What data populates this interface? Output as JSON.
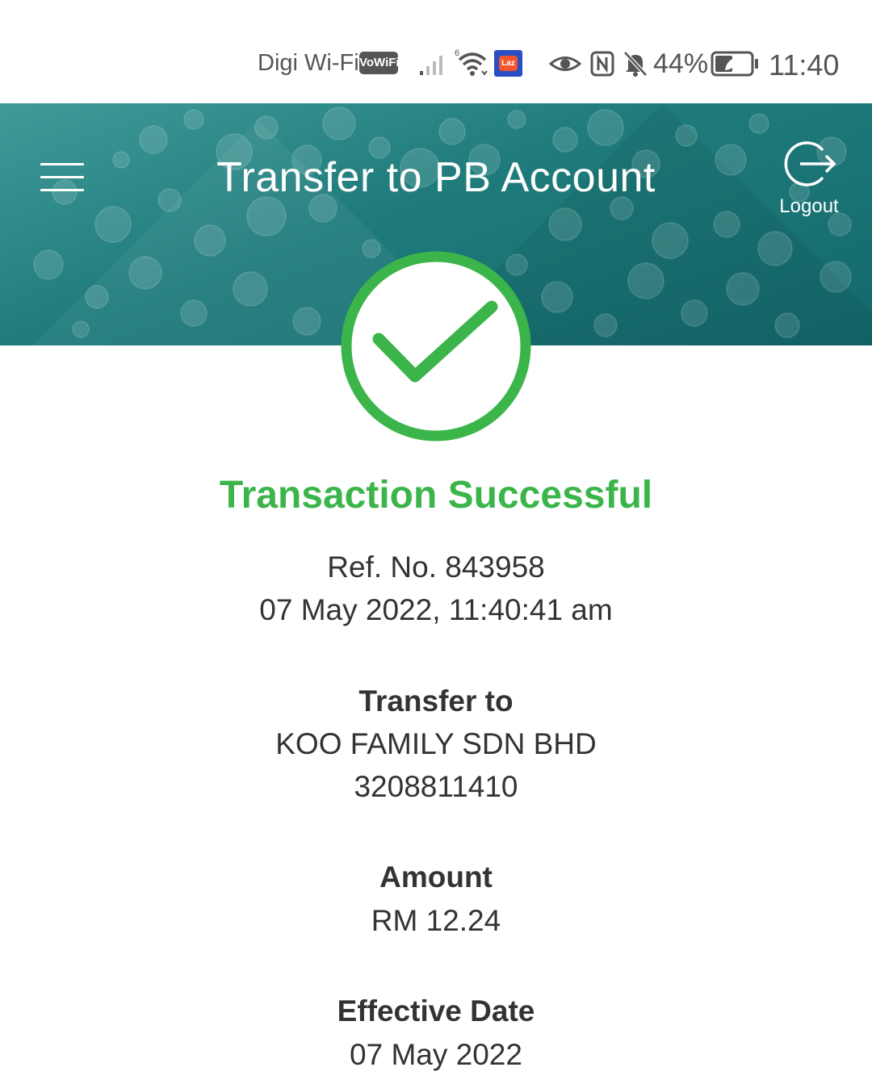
{
  "status_bar": {
    "carrier": "Digi Wi-Fi",
    "vowifi_badge": "VoWiFi",
    "laz_label": "Laz",
    "battery_percent": "44%",
    "time": "11:40",
    "icons": [
      "signal-icon",
      "wifi-icon",
      "lazada-app-icon",
      "eye-icon",
      "nfc-icon",
      "bell-muted-icon",
      "battery-icon"
    ]
  },
  "header": {
    "title": "Transfer to PB Account",
    "logout_label": "Logout",
    "accent_color": "#1f7b7b"
  },
  "result": {
    "status": "Transaction Successful",
    "status_color": "#3bb54a",
    "ref_no": "Ref. No.  843958",
    "datetime": "07 May 2022, 11:40:41 am"
  },
  "transfer_to": {
    "label": "Transfer to",
    "name": "KOO FAMILY SDN BHD",
    "account": "3208811410"
  },
  "amount": {
    "label": "Amount",
    "value": "RM 12.24"
  },
  "effective_date": {
    "label": "Effective Date",
    "value": "07 May 2022"
  }
}
